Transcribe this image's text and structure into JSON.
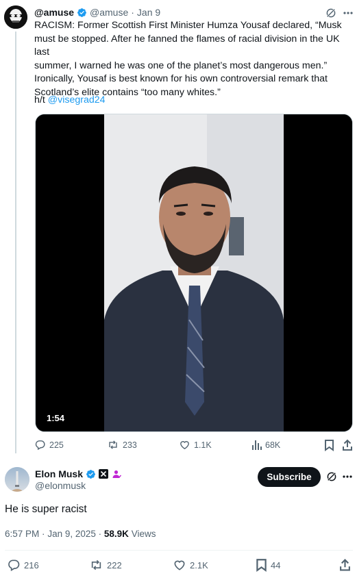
{
  "quoted_tweet": {
    "display_name": "@amuse",
    "handle": "@amuse",
    "separator": "·",
    "date": "Jan 9",
    "text_lines": [
      "RACISM: Former Scottish First Minister Humza Yousaf declared, “Musk",
      "must be stopped. After he fanned the flames of racial division in the UK last",
      "summer, I warned he was one of the planet’s most dangerous men.”",
      "Ironically, Yousaf is best known for his own controversial remark that",
      "Scotland’s elite contains “too many whites.”"
    ],
    "hat_tip_prefix": "h/t ",
    "hat_tip_link": "@visegrad24",
    "video": {
      "duration": "1:54"
    },
    "actions": {
      "replies": "225",
      "reposts": "233",
      "likes": "1.1K",
      "views": "68K"
    }
  },
  "main_tweet": {
    "display_name": "Elon Musk",
    "handle": "@elonmusk",
    "subscribe_label": "Subscribe",
    "text": "He is super racist",
    "time": "6:57 PM",
    "separator": "·",
    "date": "Jan 9, 2025",
    "meta_separator": "·",
    "views_count": "58.9K",
    "views_label": "Views",
    "actions": {
      "replies": "216",
      "reposts": "222",
      "likes": "2.1K",
      "bookmarks": "44"
    }
  },
  "colors": {
    "text": "#0f1419",
    "muted": "#536471",
    "link": "#1d9bf0",
    "verified": "#1d9bf0",
    "affiliate": "#c026d3",
    "button_bg": "#0f1419"
  },
  "icons": [
    "verified-badge-icon",
    "grok-icon",
    "more-icon",
    "reply-icon",
    "repost-icon",
    "like-icon",
    "views-icon",
    "bookmark-icon",
    "share-icon",
    "x-logo-icon",
    "affiliate-icon"
  ]
}
